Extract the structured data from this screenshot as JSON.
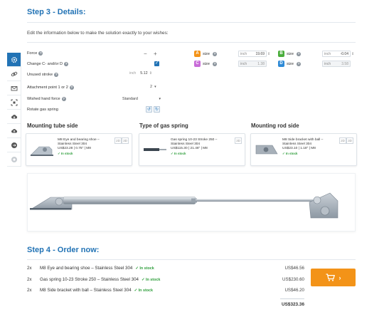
{
  "step3": {
    "num": "Step 3",
    "sep": " - ",
    "title": "Details:"
  },
  "intro": "Edit the information below to make the solution exactly to your wishes:",
  "sidebar": [
    {
      "icon": "gear-icon"
    },
    {
      "icon": "link-icon"
    },
    {
      "icon": "mail-icon"
    },
    {
      "icon": "scan-icon"
    },
    {
      "icon": "cloud-download-icon"
    },
    {
      "icon": "cloud-upload-icon"
    },
    {
      "icon": "circle-arrow-icon"
    },
    {
      "icon": "circle-icon"
    }
  ],
  "form": {
    "force_label": "Force",
    "force_minus": "−",
    "force_plus": "+",
    "change_label": "Change C- and/or D",
    "unused_stroke_label": "Unused stroke",
    "unused_stroke_unit": "inch",
    "unused_stroke_value": "5.12",
    "attachment_label": "Attachment point 1 or 2",
    "attachment_value": "2",
    "hand_force_label": "Wished hand force",
    "hand_force_value": "Standard",
    "rotate_label": "Rotate gas spring"
  },
  "sizes": [
    {
      "letter": "A",
      "label": "size",
      "unit": "inch",
      "value": "19.69",
      "color": "#f39318"
    },
    {
      "letter": "B",
      "label": "size",
      "unit": "inch",
      "value": "-0.04",
      "color": "#4aad3b"
    },
    {
      "letter": "C",
      "label": "size",
      "unit": "inch",
      "value": "1.38",
      "color": "#c86bd8"
    },
    {
      "letter": "D",
      "label": "size",
      "unit": "inch",
      "value": "3.58",
      "color": "#2f8ad6"
    }
  ],
  "parts": [
    {
      "title": "Mounting tube side",
      "name": "M8 Eye and bearing shoe – Stainless Steel 304",
      "info": "US$23.28 | 0.75\" | M8",
      "stock": "✓ In stock",
      "btn2d": "2D",
      "btn3d": "3D"
    },
    {
      "title": "Type of gas spring",
      "name": "Gas spring 10-23 Stroke 250 – Stainless Steel 304",
      "info": "US$115.30 | 21.46\" | M8",
      "stock": "✓ In stock",
      "btn2d": "",
      "btn3d": "3D"
    },
    {
      "title": "Mounting rod side",
      "name": "M8 Side bracket with ball – Stainless Steel 304",
      "info": "US$23.10 | 1.18\" | M8",
      "stock": "✓ In stock",
      "btn2d": "2D",
      "btn3d": "3D"
    }
  ],
  "step4": {
    "num": "Step 4",
    "sep": " - ",
    "title": "Order now:"
  },
  "order": [
    {
      "qty": "2x",
      "name": "M8 Eye and bearing shoe – Stainless Steel 304",
      "stock": "✓ In stock",
      "price": "US$46.56"
    },
    {
      "qty": "2x",
      "name": "Gas spring 10-23 Stroke 250 – Stainless Steel 304",
      "stock": "✓ In stock",
      "price": "US$230.60"
    },
    {
      "qty": "2x",
      "name": "M8 Side bracket with ball – Stainless Steel 304",
      "stock": "✓ In stock",
      "price": "US$46.20"
    }
  ],
  "total": "US$323.36",
  "colors": {
    "accent": "#2273b5",
    "cart": "#f39318",
    "stock": "#2e9e3b"
  }
}
